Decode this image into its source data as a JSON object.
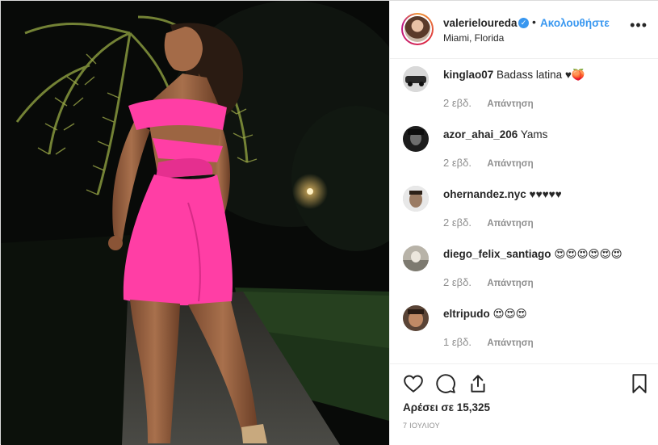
{
  "header": {
    "username": "valerieloureda",
    "separator": "•",
    "follow_label": "Ακολουθήστε",
    "location": "Miami, Florida",
    "more_label": "•••",
    "verified_label": "✓"
  },
  "comments": [
    {
      "username": "kinglao07",
      "text": "Badass latina ♥🍑",
      "time": "2 εβδ.",
      "reply": "Απάντηση"
    },
    {
      "username": "azor_ahai_206",
      "text": "Yams",
      "time": "2 εβδ.",
      "reply": "Απάντηση"
    },
    {
      "username": "ohernandez.nyc",
      "text": "♥♥♥♥♥",
      "time": "2 εβδ.",
      "reply": "Απάντηση"
    },
    {
      "username": "diego_felix_santiago",
      "text": "😍😍😍😍😍😍",
      "time": "2 εβδ.",
      "reply": "Απάντηση"
    },
    {
      "username": "eltripudo",
      "text": "😍😍😍",
      "time": "1 εβδ.",
      "reply": "Απάντηση"
    }
  ],
  "likes": "Αρέσει σε 15,325",
  "date": "7 ΙΟΥΛΙΟΥ",
  "colors": {
    "accent": "#3897f0",
    "dress": "#ff3ea5",
    "muted": "#8e8e8e"
  },
  "icons": [
    "heart-icon",
    "comment-icon",
    "share-icon",
    "bookmark-icon",
    "more-icon",
    "verified-icon"
  ]
}
